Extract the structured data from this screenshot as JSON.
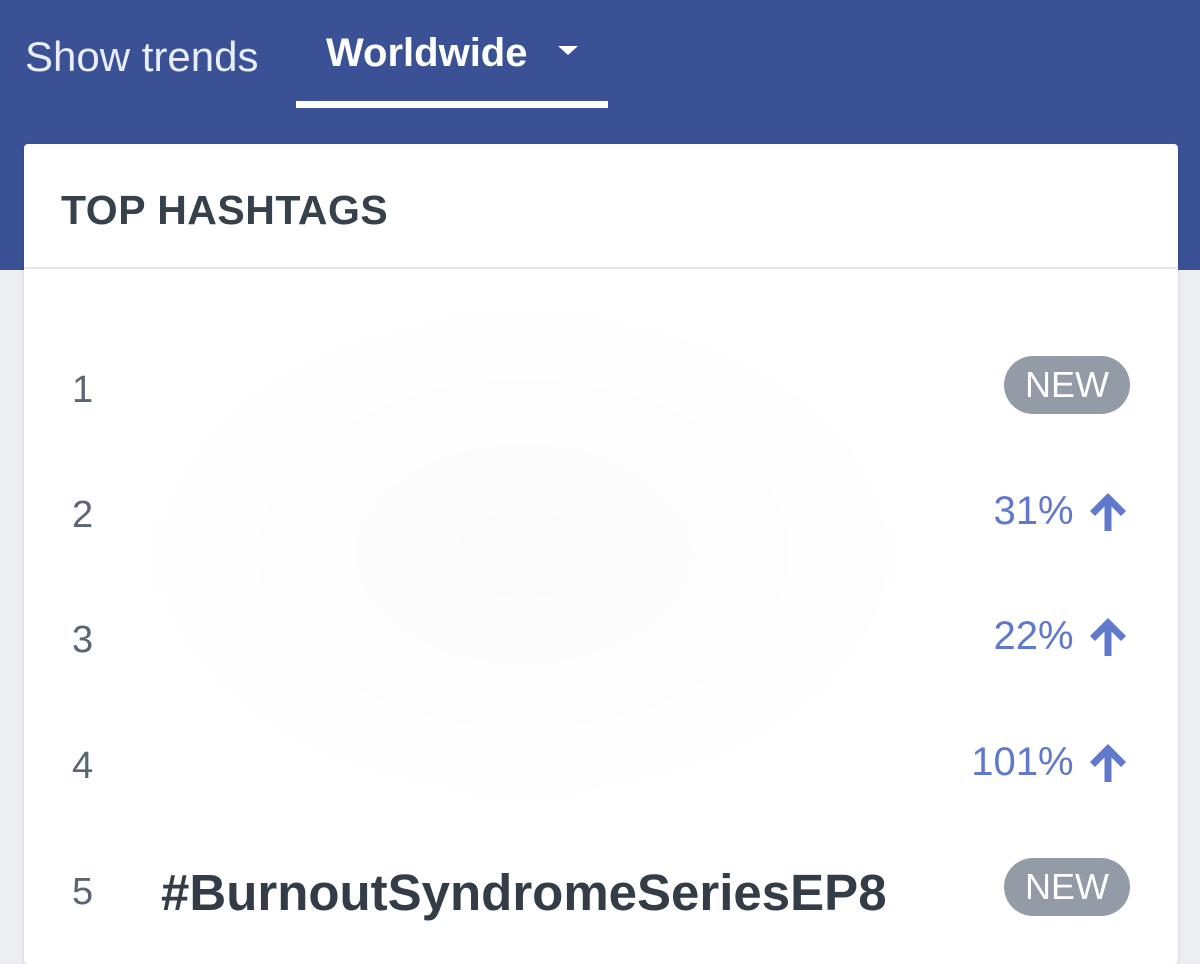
{
  "header": {
    "show_trends_label": "Show trends",
    "region_label": "Worldwide"
  },
  "card": {
    "title": "TOP HASHTAGS"
  },
  "hashtags": [
    {
      "rank": "1",
      "tag": "",
      "badge": "NEW"
    },
    {
      "rank": "2",
      "tag": "",
      "change": "31%",
      "direction": "up"
    },
    {
      "rank": "3",
      "tag": "",
      "change": "22%",
      "direction": "up"
    },
    {
      "rank": "4",
      "tag": "",
      "change": "101%",
      "direction": "up"
    },
    {
      "rank": "5",
      "tag": "#BurnoutSyndromeSeriesEP8",
      "badge": "NEW"
    }
  ],
  "colors": {
    "header_bg": "#3a5196",
    "trend_up": "#6079cc",
    "badge_bg": "#929ba6",
    "page_bg": "#eceef1"
  },
  "icons": {
    "region_dropdown": "caret-down-icon",
    "trend_up": "arrow-up-icon"
  }
}
